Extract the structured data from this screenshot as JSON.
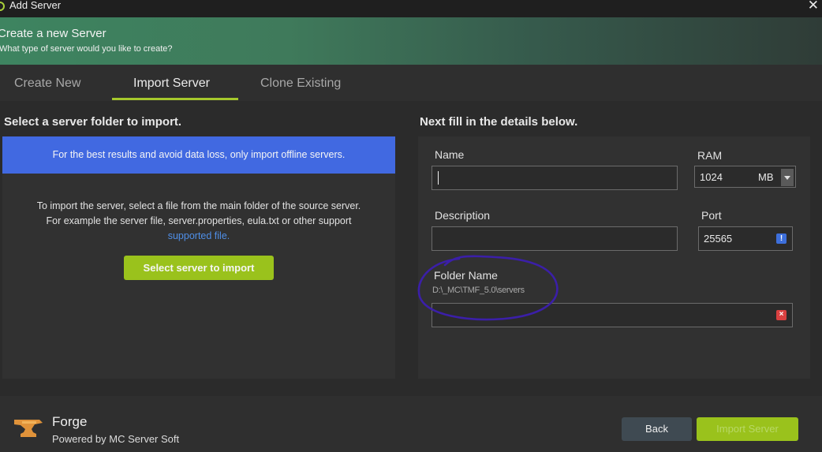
{
  "window": {
    "title": "Add Server",
    "close_glyph": "✕"
  },
  "header": {
    "title": "Create a new Server",
    "subtitle": "What type of server would you like to create?"
  },
  "tabs": [
    {
      "label": "Create New",
      "active": false
    },
    {
      "label": "Import Server",
      "active": true
    },
    {
      "label": "Clone Existing",
      "active": false
    }
  ],
  "left": {
    "title": "Select a server folder to import.",
    "banner": "For the best results and avoid data loss, only import offline servers.",
    "instructions": "To import the server, select a file from the main folder of the source server. For example the server file, server.properties, eula.txt or other support",
    "link": "supported file.",
    "select_button": "Select server to import"
  },
  "right": {
    "title": "Next fill in the details below.",
    "name": {
      "label": "Name",
      "value": ""
    },
    "ram": {
      "label": "RAM",
      "value": "1024",
      "unit": "MB"
    },
    "description": {
      "label": "Description",
      "value": ""
    },
    "port": {
      "label": "Port",
      "value": "25565",
      "warning_glyph": "!"
    },
    "folder": {
      "label": "Folder Name",
      "path": "D:\\_MC\\TMF_5.0\\servers",
      "value": "",
      "error_glyph": "×"
    }
  },
  "footer": {
    "brand": "Forge",
    "powered_by": "Powered by MC Server Soft",
    "back_button": "Back",
    "import_button": "Import Server"
  },
  "colors": {
    "accent_green": "#9ac21c",
    "banner_blue": "#4169e1",
    "annotation_circle": "#3b1fa8",
    "error_red": "#d94040"
  }
}
